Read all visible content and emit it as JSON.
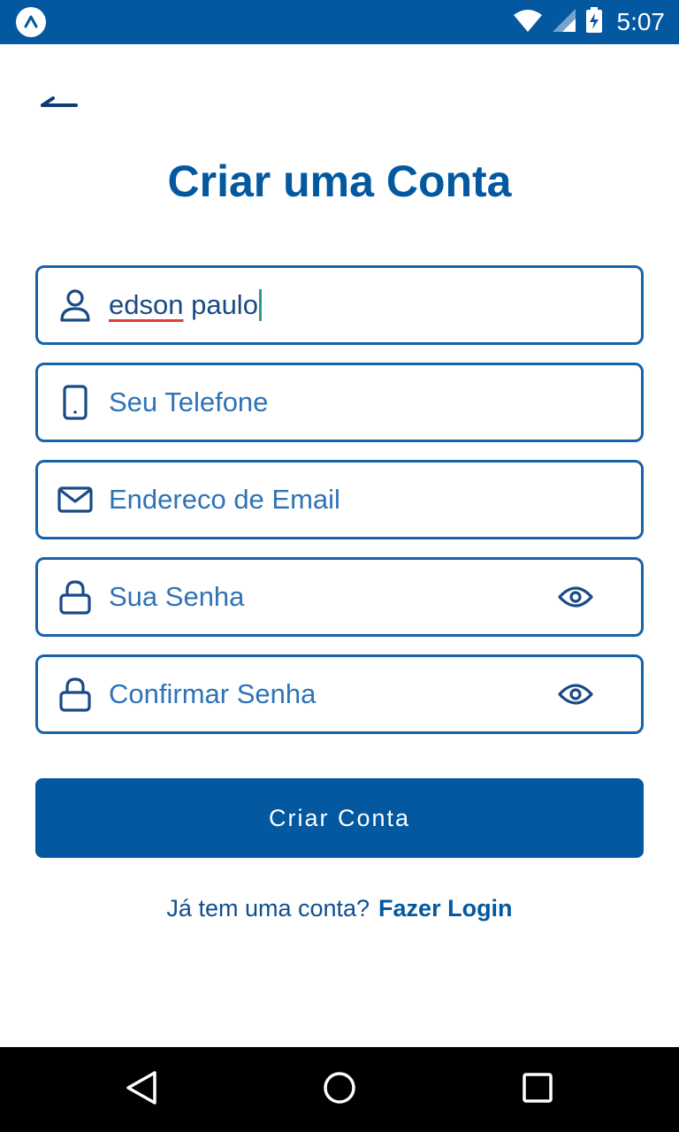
{
  "status_bar": {
    "time": "5:07",
    "icons": [
      "app-badge-icon",
      "wifi-icon",
      "signal-icon",
      "battery-charging-icon"
    ]
  },
  "header": {
    "back_icon": "arrow-left-icon",
    "title": "Criar uma Conta"
  },
  "form": {
    "name": {
      "value_misspelled": "edson",
      "value_rest": " paulo",
      "icon": "user-icon"
    },
    "phone": {
      "placeholder": "Seu Telefone",
      "icon": "phone-icon"
    },
    "email": {
      "placeholder": "Endereco de Email",
      "icon": "mail-icon"
    },
    "password": {
      "placeholder": "Sua Senha",
      "icon": "lock-icon",
      "toggle_icon": "eye-icon"
    },
    "confirm_password": {
      "placeholder": "Confirmar Senha",
      "icon": "lock-icon",
      "toggle_icon": "eye-icon"
    },
    "submit_label": "Criar Conta"
  },
  "footer": {
    "prompt": "Já tem uma conta?",
    "link_label": "Fazer Login"
  },
  "nav_bar": {
    "icons": [
      "back-triangle-icon",
      "home-circle-icon",
      "recents-square-icon"
    ]
  },
  "colors": {
    "brand": "#0358a0",
    "field_border": "#1763aa",
    "placeholder": "#2f73b6",
    "caret": "#2a9d8f",
    "spellcheck": "#e23b3b"
  }
}
